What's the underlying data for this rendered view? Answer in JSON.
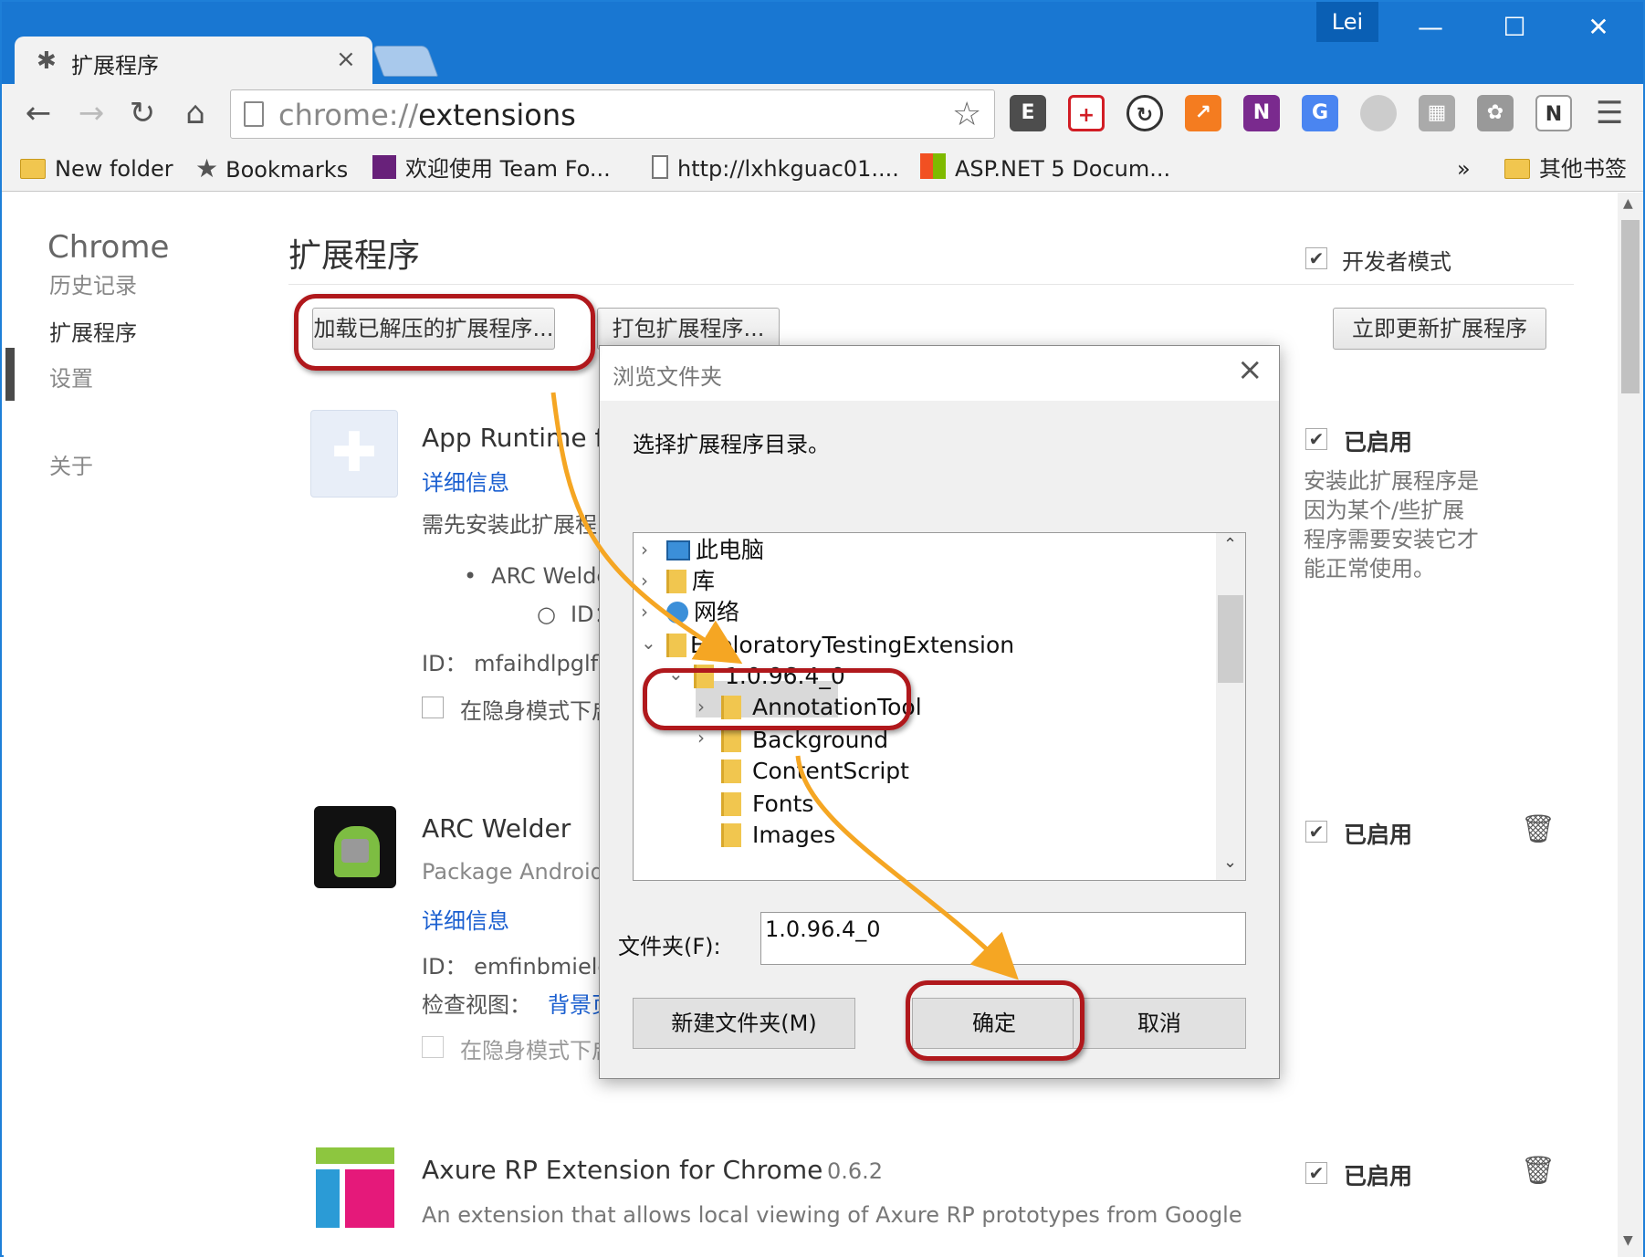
{
  "window": {
    "user": "Lei",
    "minimize": "—",
    "maximize": "☐",
    "close": "✕"
  },
  "tab": {
    "title": "扩展程序",
    "close": "×"
  },
  "toolbar": {
    "url_scheme": "chrome://",
    "url_host": "extensions",
    "back": "←",
    "forward": "→",
    "reload": "↻",
    "home": "⌂"
  },
  "bookmarks": [
    {
      "label": "New folder",
      "icon": "folder-icon"
    },
    {
      "label": "Bookmarks",
      "icon": "star-icon"
    },
    {
      "label": "欢迎使用 Team Fo...",
      "icon": "visual-studio-icon"
    },
    {
      "label": "http://lxhkguac01....",
      "icon": "page-icon"
    },
    {
      "label": "ASP.NET 5 Docum...",
      "icon": "windows-icon"
    },
    {
      "label": "»",
      "icon": ""
    },
    {
      "label": "其他书签",
      "icon": "folder-icon"
    }
  ],
  "sidebar": {
    "title": "Chrome",
    "items": [
      {
        "label": "历史记录"
      },
      {
        "label": "扩展程序"
      },
      {
        "label": "设置"
      },
      {
        "label": "关于"
      }
    ]
  },
  "main": {
    "title": "扩展程序",
    "developer_mode": "开发者模式",
    "load_unpacked": "加载已解压的扩展程序...",
    "pack": "打包扩展程序...",
    "update_now": "立即更新扩展程序"
  },
  "extensions": [
    {
      "name": "App Runtime fo",
      "details": "详细信息",
      "description": "需先安装此扩展程",
      "bullet": "ARC Welde",
      "sub_bullet": "ID：",
      "id": "ID： mfaihdlpglflfg",
      "incognito": "在隐身模式下启",
      "enabled": "已启用",
      "note": "安装此扩展程序是因为某个/些扩展程序需要安装它才能正常使用。"
    },
    {
      "name": "ARC Welder",
      "description": "Package Android",
      "details": "详细信息",
      "id": "ID： emfinbmieloc",
      "inspect_label": "检查视图：",
      "inspect_link": "背景页",
      "incognito": "在隐身模式下启",
      "enabled": "已启用"
    },
    {
      "name": "Axure RP Extension for Chrome",
      "version": "0.6.2",
      "description": "An extension that allows local viewing of Axure RP prototypes from Google",
      "enabled": "已启用"
    }
  ],
  "dialog": {
    "title": "浏览文件夹",
    "message": "选择扩展程序目录。",
    "tree": [
      {
        "label": "此电脑",
        "level": 0,
        "arrow": "›"
      },
      {
        "label": "库",
        "level": 0,
        "arrow": "›"
      },
      {
        "label": "网络",
        "level": 0,
        "arrow": "›"
      },
      {
        "label": "ExploratoryTestingExtension",
        "level": 0,
        "arrow": "⌄"
      },
      {
        "label": "1.0.96.4_0",
        "level": 1,
        "arrow": "⌄",
        "selected": true
      },
      {
        "label": "AnnotationTool",
        "level": 2,
        "arrow": "›"
      },
      {
        "label": "Background",
        "level": 2,
        "arrow": "›"
      },
      {
        "label": "ContentScript",
        "level": 2,
        "arrow": ""
      },
      {
        "label": "Fonts",
        "level": 2,
        "arrow": ""
      },
      {
        "label": "Images",
        "level": 2,
        "arrow": ""
      }
    ],
    "folder_label": "文件夹(F):",
    "folder_value": "1.0.96.4_0",
    "new_folder": "新建文件夹(M)",
    "ok": "确定",
    "cancel": "取消"
  },
  "colors": {
    "titlebar": "#1977d2",
    "callout": "#b0181c",
    "arrow": "#f5a623",
    "link": "#1a5fd0"
  }
}
